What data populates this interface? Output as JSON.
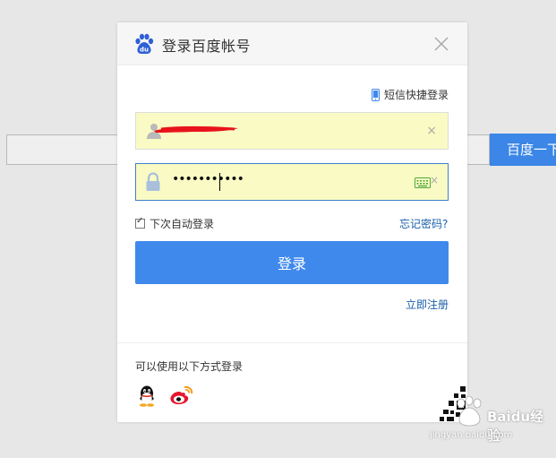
{
  "background": {
    "search_button_label": "百度一下"
  },
  "dialog": {
    "title": "登录百度帐号",
    "sms_login_label": "短信快捷登录",
    "username": {
      "value": "",
      "clear": "×"
    },
    "password": {
      "value": "•••••••••••",
      "clear": "×"
    },
    "remember_label": "下次自动登录",
    "remember_checked": true,
    "forgot_label": "忘记密码?",
    "login_button_label": "登录",
    "register_label": "立即注册",
    "other_login_label": "可以使用以下方式登录"
  },
  "watermark": {
    "brand": "Baidu经验",
    "url": "jingyan.baidu.com"
  },
  "colors": {
    "accent": "#3f89ec",
    "link": "#1a5fa8",
    "field_bg": "#fafbc4",
    "background": "#e7e7e7"
  }
}
